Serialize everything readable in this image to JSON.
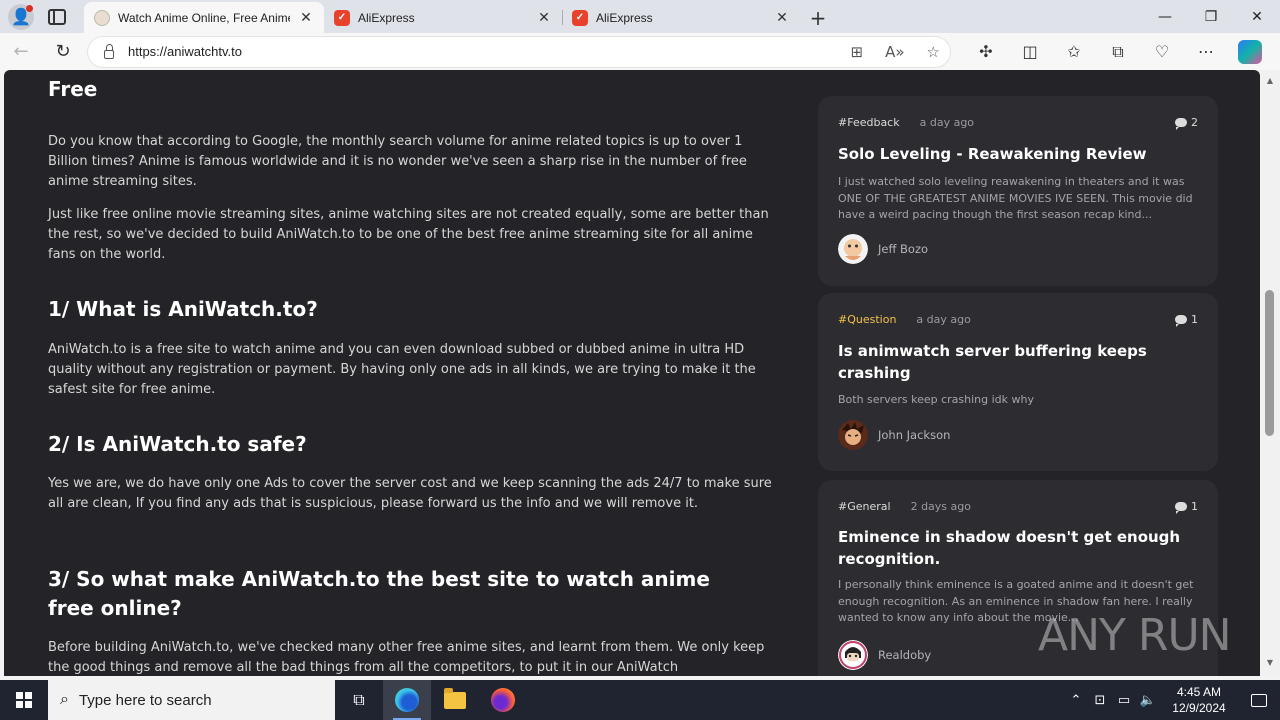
{
  "browser": {
    "tabs": [
      {
        "title": "Watch Anime Online, Free Anime",
        "favicon": "anime-favicon",
        "active": true
      },
      {
        "title": "AliExpress",
        "favicon": "aliexpress-favicon",
        "active": false
      },
      {
        "title": "AliExpress",
        "favicon": "aliexpress-favicon",
        "active": false
      }
    ],
    "new_tab_label": "+",
    "window_controls": {
      "minimize": "—",
      "restore": "❐",
      "close": "✕"
    },
    "url": "https://aniwatchtv.to",
    "icons": {
      "back": "←",
      "refresh": "↻",
      "apps": "⊞",
      "read_aloud": "A»",
      "favorite": "☆",
      "extensions": "✣",
      "split": "◫",
      "favorites": "✩",
      "collections": "⧉",
      "performance": "♡",
      "menu": "⋯"
    }
  },
  "article": {
    "heading_partial": "Free",
    "intro_p1": "Do you know that according to Google, the monthly search volume for anime related topics is up to over 1 Billion times? Anime is famous worldwide and it is no wonder we've seen a sharp rise in the number of free anime streaming sites.",
    "intro_p2": "Just like free online movie streaming sites, anime watching sites are not created equally, some are better than the rest, so we've decided to build AniWatch.to to be one of the best free anime streaming site for all anime fans on the world.",
    "s1_title": "1/ What is AniWatch.to?",
    "s1_body": "AniWatch.to is a free site to watch anime and you can even download subbed or dubbed anime in ultra HD quality without any registration or payment. By having only one ads in all kinds, we are trying to make it the safest site for free anime.",
    "s2_title": "2/ Is AniWatch.to safe?",
    "s2_body": "Yes we are, we do have only one Ads to cover the server cost and we keep scanning the ads 24/7 to make sure all are clean, If you find any ads that is suspicious, please forward us the info and we will remove it.",
    "s3_title": "3/ So what make AniWatch.to the best site to watch anime free online?",
    "s3_body": "Before building AniWatch.to, we've checked many other free anime sites, and learnt from them. We only keep the good things and remove all the bad things from all the competitors, to put it in our AniWatch"
  },
  "sidebar": {
    "posts": [
      {
        "tag": "#Feedback",
        "time": "a day ago",
        "comments": "2",
        "title": "Solo Leveling - Reawakening Review",
        "body": "I just watched solo leveling reawakening in theaters and it was ONE OF THE GREATEST ANIME MOVIES IVE SEEN. This movie did have a weird pacing though the first season recap kind...",
        "author": "Jeff Bozo",
        "tag_color": "#dcdcdc"
      },
      {
        "tag": "#Question",
        "time": "a day ago",
        "comments": "1",
        "title": "Is animwatch server buffering keeps crashing",
        "body": "Both servers keep crashing idk why",
        "author": "John Jackson",
        "tag_color": "#f5c04a"
      },
      {
        "tag": "#General",
        "time": "2 days ago",
        "comments": "1",
        "title": "Eminence in shadow doesn't get enough recognition.",
        "body": "I personally think eminence is a goated anime and it doesn't get enough recognition. As an eminence in shadow fan here. I really wanted to know any info about the movie...",
        "author": "Realdoby",
        "tag_color": "#dcdcdc"
      }
    ]
  },
  "watermark": "ANY RUN",
  "taskbar": {
    "search_placeholder": "Type here to search",
    "time": "4:45 AM",
    "date": "12/9/2024"
  }
}
